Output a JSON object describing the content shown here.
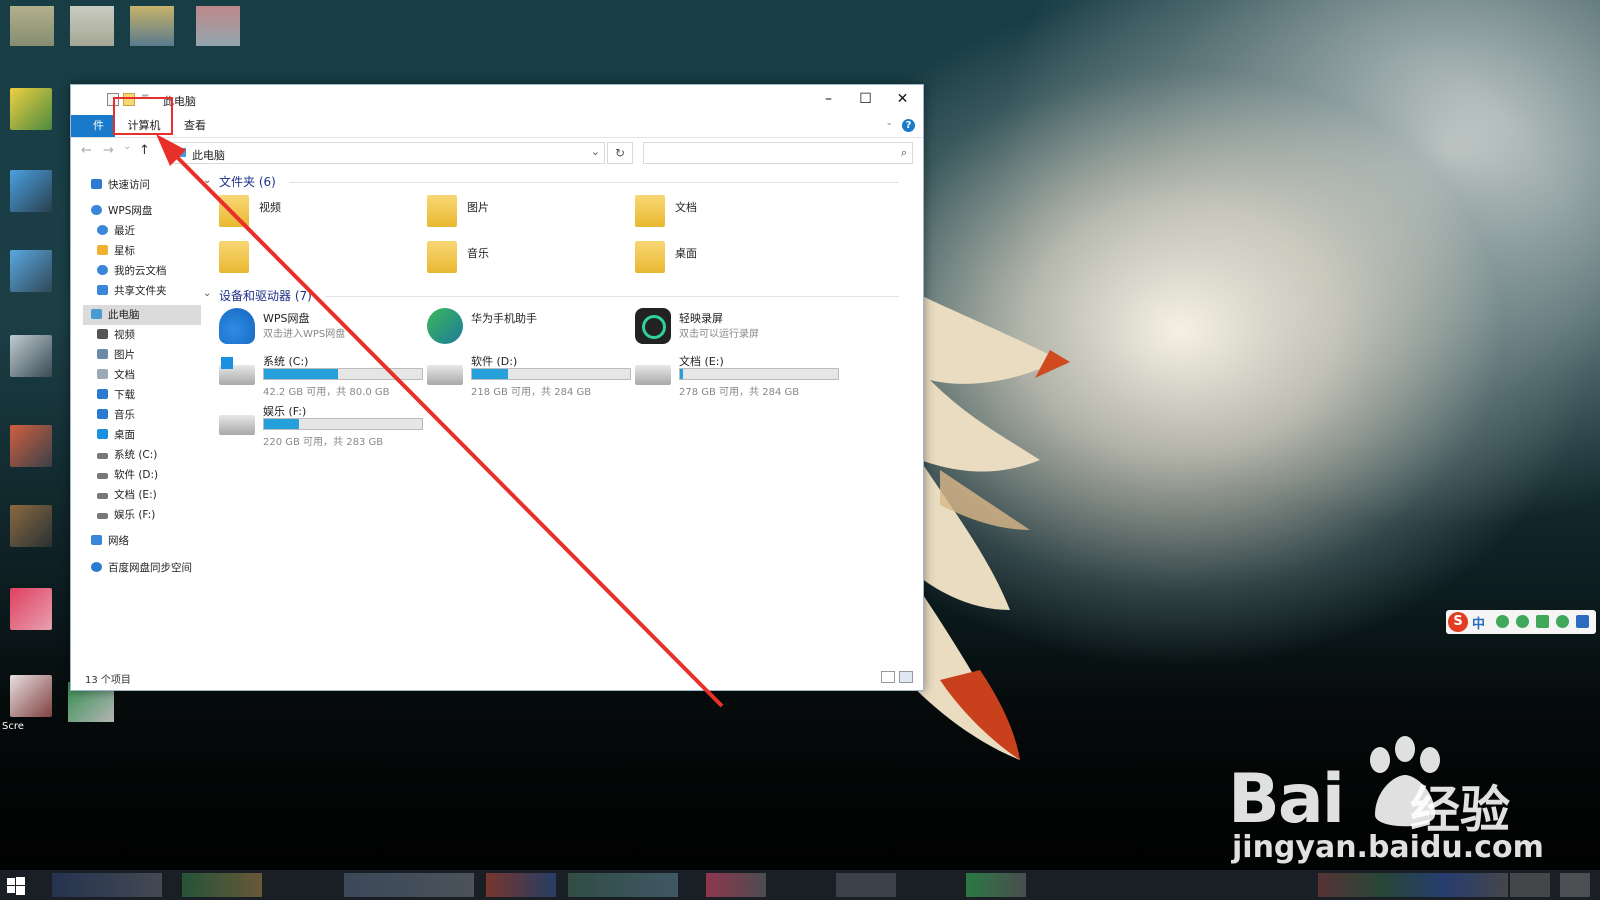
{
  "window": {
    "title": "此电脑",
    "controls": {
      "minimize": "–",
      "maximize": "☐",
      "close": "✕"
    }
  },
  "ribbon": {
    "file_tab": "件",
    "tabs": [
      "计算机",
      "查看"
    ],
    "help": "?"
  },
  "nav": {
    "back": "←",
    "forward": "→",
    "recent": "⌄",
    "up": "↑",
    "address": "此电脑",
    "address_dropdown": "⌄",
    "refresh": "↻",
    "search_placeholder": "",
    "search_icon": "⌕"
  },
  "sidebar": {
    "items": [
      {
        "label": "快速访问",
        "icon": "star-icon",
        "color": "#2b7bd1"
      },
      {
        "label": "WPS网盘",
        "icon": "cloud-icon",
        "color": "#3a86d8"
      },
      {
        "label": "最近",
        "icon": "clock-icon",
        "color": "#3a86d8"
      },
      {
        "label": "星标",
        "icon": "star-icon",
        "color": "#f0b030"
      },
      {
        "label": "我的云文档",
        "icon": "cloud-icon",
        "color": "#3a86d8"
      },
      {
        "label": "共享文件夹",
        "icon": "share-icon",
        "color": "#3a86d8"
      },
      {
        "label": "此电脑",
        "icon": "computer-icon",
        "color": "#4a9ad4"
      },
      {
        "label": "视频",
        "icon": "video-icon",
        "color": "#555555"
      },
      {
        "label": "图片",
        "icon": "picture-icon",
        "color": "#6a8aa8"
      },
      {
        "label": "文档",
        "icon": "document-icon",
        "color": "#9aa8b8"
      },
      {
        "label": "下载",
        "icon": "download-icon",
        "color": "#2b7bd1"
      },
      {
        "label": "音乐",
        "icon": "music-icon",
        "color": "#2b7bd1"
      },
      {
        "label": "桌面",
        "icon": "desktop-icon",
        "color": "#1c8fe0"
      },
      {
        "label": "系统 (C:)",
        "icon": "drive-icon",
        "color": "#777777"
      },
      {
        "label": "软件 (D:)",
        "icon": "drive-icon",
        "color": "#777777"
      },
      {
        "label": "文档 (E:)",
        "icon": "drive-icon",
        "color": "#777777"
      },
      {
        "label": "娱乐 (F:)",
        "icon": "drive-icon",
        "color": "#777777"
      },
      {
        "label": "网络",
        "icon": "network-icon",
        "color": "#3a86d8"
      },
      {
        "label": "百度网盘同步空间",
        "icon": "baidu-sync-icon",
        "color": "#2b7bd1"
      }
    ]
  },
  "content": {
    "folders_header": "文件夹 (6)",
    "folders": [
      {
        "label": "视频",
        "icon": "video-folder-icon"
      },
      {
        "label": "图片",
        "icon": "picture-folder-icon"
      },
      {
        "label": "文档",
        "icon": "document-folder-icon"
      },
      {
        "label": "",
        "icon": "download-folder-icon"
      },
      {
        "label": "音乐",
        "icon": "music-folder-icon"
      },
      {
        "label": "桌面",
        "icon": "desktop-folder-icon"
      }
    ],
    "devices_header": "设备和驱动器 (7)",
    "apps": [
      {
        "title": "WPS网盘",
        "subtitle": "双击进入WPS网盘",
        "icon": "wps-cloud-icon"
      },
      {
        "title": "华为手机助手",
        "subtitle": "",
        "icon": "huawei-assistant-icon"
      },
      {
        "title": "轻映录屏",
        "subtitle": "双击可以运行录屏",
        "icon": "screen-recorder-icon"
      }
    ],
    "drives": [
      {
        "name": "系统 (C:)",
        "info": "42.2 GB 可用，共 80.0 GB",
        "used_fraction": 0.47,
        "icon": "windows-drive-icon"
      },
      {
        "name": "软件 (D:)",
        "info": "218 GB 可用，共 284 GB",
        "used_fraction": 0.23,
        "icon": "drive-icon"
      },
      {
        "name": "文档 (E:)",
        "info": "278 GB 可用，共 284 GB",
        "used_fraction": 0.02,
        "icon": "drive-icon"
      },
      {
        "name": "娱乐 (F:)",
        "info": "220 GB 可用，共 283 GB",
        "used_fraction": 0.22,
        "icon": "drive-icon"
      }
    ]
  },
  "status": {
    "item_count": "13 个项目"
  },
  "ime": {
    "logo": "S",
    "mode": "中"
  },
  "desktop": {
    "shortcut_label": "Scre"
  },
  "watermark": {
    "brand": "Bai",
    "brand_cn": "经验",
    "url": "jingyan.baidu.com"
  },
  "colors": {
    "accent": "#1979ca",
    "highlight_box": "#e8302a",
    "drive_fill": "#26a0da",
    "group_header": "#1e3287"
  }
}
